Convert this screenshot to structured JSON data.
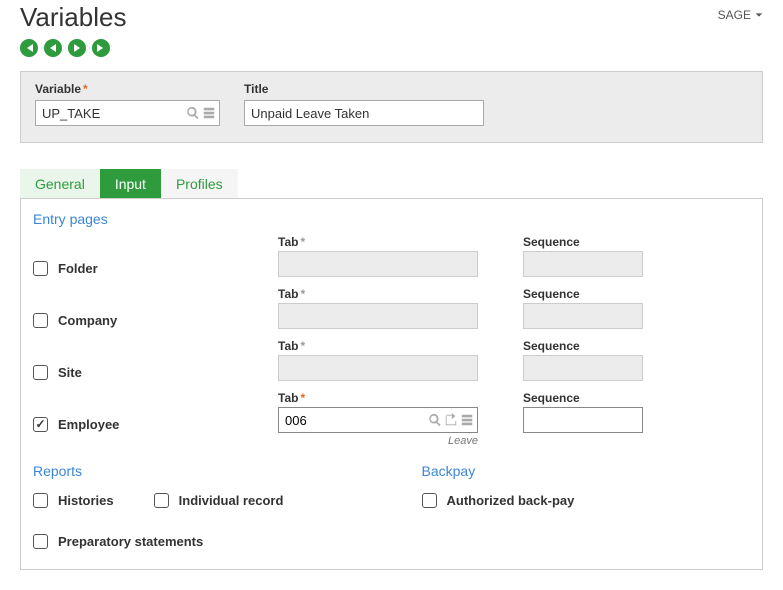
{
  "header": {
    "title": "Variables",
    "menu_label": "SAGE"
  },
  "toolbar": {
    "variable_label": "Variable",
    "variable_value": "UP_TAKE",
    "title_label": "Title",
    "title_value": "Unpaid Leave Taken"
  },
  "tabs": {
    "general": "General",
    "input": "Input",
    "profiles": "Profiles"
  },
  "entry": {
    "section": "Entry pages",
    "tab_label": "Tab",
    "sequence_label": "Sequence",
    "rows": {
      "folder": {
        "label": "Folder",
        "checked": false
      },
      "company": {
        "label": "Company",
        "checked": false
      },
      "site": {
        "label": "Site",
        "checked": false
      },
      "employee": {
        "label": "Employee",
        "checked": true,
        "tab_value": "006",
        "helper": "Leave",
        "sequence_value": ""
      }
    }
  },
  "reports": {
    "section": "Reports",
    "histories": "Histories",
    "individual": "Individual record",
    "preparatory": "Preparatory statements"
  },
  "backpay": {
    "section": "Backpay",
    "authorized": "Authorized back-pay"
  }
}
